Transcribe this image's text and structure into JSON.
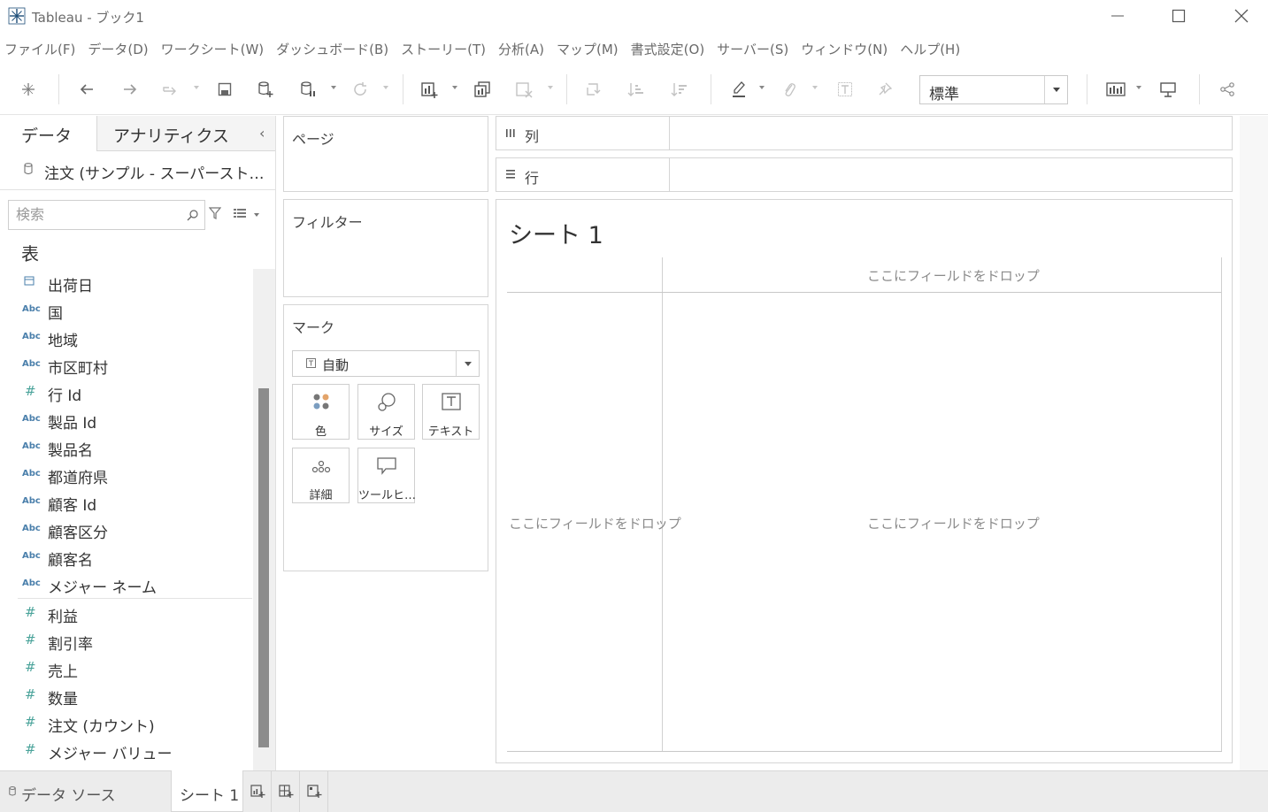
{
  "window": {
    "title": "Tableau - ブック1"
  },
  "menu": {
    "items": [
      "ファイル(F)",
      "データ(D)",
      "ワークシート(W)",
      "ダッシュボード(B)",
      "ストーリー(T)",
      "分析(A)",
      "マップ(M)",
      "書式設定(O)",
      "サーバー(S)",
      "ウィンドウ(N)",
      "ヘルプ(H)"
    ]
  },
  "toolbar": {
    "fit_value": "標準"
  },
  "data_pane": {
    "tabs": [
      "データ",
      "アナリティクス"
    ],
    "datasource": "注文 (サンプル - スーパースト…",
    "search_placeholder": "検索",
    "section": "表",
    "fields": [
      {
        "type": "date",
        "icon": "▭",
        "name": "出荷日"
      },
      {
        "type": "string",
        "icon": "Abc",
        "name": "国"
      },
      {
        "type": "string",
        "icon": "Abc",
        "name": "地域"
      },
      {
        "type": "string",
        "icon": "Abc",
        "name": "市区町村"
      },
      {
        "type": "number",
        "icon": "#",
        "name": "行 Id"
      },
      {
        "type": "string",
        "icon": "Abc",
        "name": "製品 Id"
      },
      {
        "type": "string",
        "icon": "Abc",
        "name": "製品名"
      },
      {
        "type": "string",
        "icon": "Abc",
        "name": "都道府県"
      },
      {
        "type": "string",
        "icon": "Abc",
        "name": "顧客 Id"
      },
      {
        "type": "string",
        "icon": "Abc",
        "name": "顧客区分"
      },
      {
        "type": "string",
        "icon": "Abc",
        "name": "顧客名"
      },
      {
        "type": "string",
        "icon": "Abc",
        "name": "メジャー ネーム"
      },
      {
        "type": "number",
        "icon": "#",
        "name": "利益"
      },
      {
        "type": "number",
        "icon": "#",
        "name": "割引率"
      },
      {
        "type": "number",
        "icon": "#",
        "name": "売上"
      },
      {
        "type": "number",
        "icon": "#",
        "name": "数量"
      },
      {
        "type": "number",
        "icon": "#",
        "name": "注文 (カウント)"
      },
      {
        "type": "number",
        "icon": "#",
        "name": "メジャー バリュー"
      }
    ]
  },
  "cards": {
    "pages": "ページ",
    "filters": "フィルター",
    "marks": "マーク",
    "mark_type": "自動",
    "mark_buttons": [
      "色",
      "サイズ",
      "テキスト",
      "詳細",
      "ツールヒ…"
    ]
  },
  "shelves": {
    "columns": "列",
    "rows": "行"
  },
  "sheet": {
    "title": "シート 1",
    "drop_top": "ここにフィールドをドロップ",
    "drop_left": "ここにフィールドをドロップ",
    "drop_center": "ここにフィールドをドロップ"
  },
  "tabs": {
    "datasource": "データ ソース",
    "sheet": "シート 1"
  },
  "colors": {
    "string_icon": "#4a7fab",
    "number_icon": "#4aa39a",
    "scroll_thumb": "#8c8c8c"
  }
}
